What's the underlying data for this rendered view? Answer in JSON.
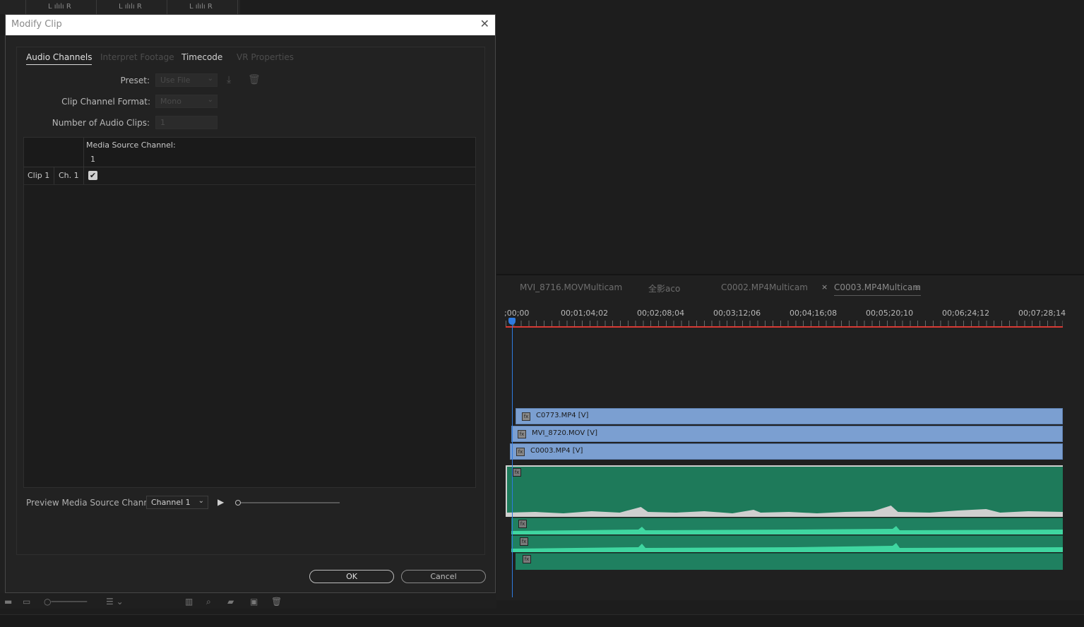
{
  "background": {
    "meter_labels": [
      "L ılılı R",
      "L ılılı R",
      "L ılılı R"
    ],
    "timeline": {
      "tabs": [
        "MVI_8716.MOVMulticam",
        "全影aco",
        "C0002.MP4Multicam",
        "C0003.MP4Multicam"
      ],
      "active_tab_close": "×",
      "menu_icon": "≡",
      "ruler": [
        ";00;00",
        "00;01;04;02",
        "00;02;08;04",
        "00;03;12;06",
        "00;04;16;08",
        "00;05;20;10",
        "00;06;24;12",
        "00;07;28;14"
      ],
      "video_clips": [
        "C0773.MP4 [V]",
        "MVI_8720.MOV [V]",
        "C0003.MP4 [V]"
      ],
      "fx_badge": "fx"
    }
  },
  "dialog": {
    "title": "Modify Clip",
    "close_glyph": "✕",
    "tabs": [
      {
        "label": "Audio Channels",
        "state": "active"
      },
      {
        "label": "Interpret Footage",
        "state": "disabled"
      },
      {
        "label": "Timecode",
        "state": "normal"
      },
      {
        "label": "VR Properties",
        "state": "disabled"
      }
    ],
    "form": {
      "preset_label": "Preset:",
      "preset_value": "Use File",
      "channel_format_label": "Clip Channel Format:",
      "channel_format_value": "Mono",
      "num_clips_label": "Number of Audio Clips:",
      "num_clips_value": "1"
    },
    "grid": {
      "header": "Media Source Channel:",
      "channel_number": "1",
      "rows": [
        {
          "clip": "Clip 1",
          "channel": "Ch. 1",
          "checked": true
        }
      ],
      "check_glyph": "✔"
    },
    "preview": {
      "label": "Preview Media Source Channel:",
      "value": "Channel 1",
      "play_glyph": "▶"
    },
    "ok_label": "OK",
    "cancel_label": "Cancel"
  },
  "colors": {
    "video_clip": "#7b9fd1",
    "audio_clip": "#1f8060",
    "playhead": "#2f7be0",
    "work_area": "#d83a34"
  }
}
